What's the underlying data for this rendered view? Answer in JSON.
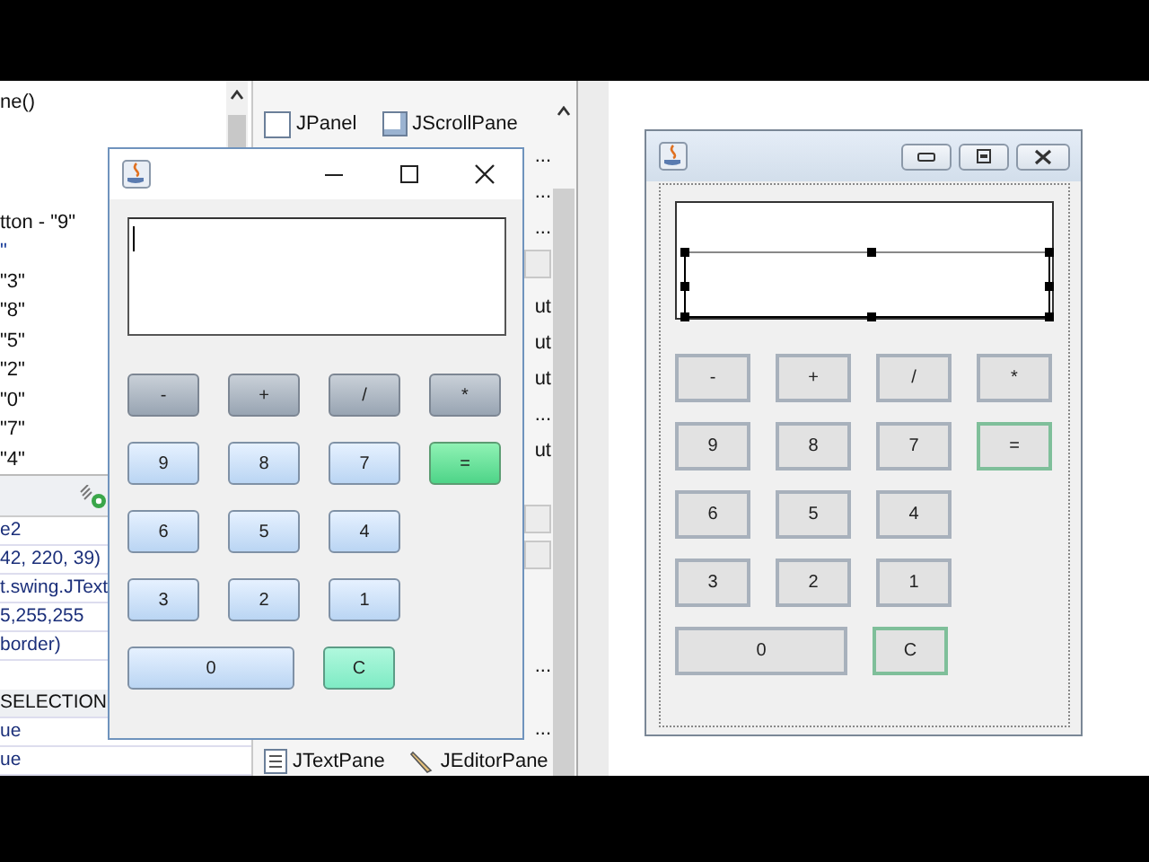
{
  "navigator": {
    "items": [
      "ne()",
      "tton - \"9\"",
      "\"",
      "\"3\"",
      "\"8\"",
      "\"5\"",
      "\"2\"",
      "\"0\"",
      "\"7\"",
      "\"4\""
    ]
  },
  "properties": {
    "rows": [
      {
        "text": "e2",
        "kind": "value"
      },
      {
        "text": "42, 220, 39)",
        "kind": "value"
      },
      {
        "text": "t.swing.JText",
        "kind": "value"
      },
      {
        "text": "5,255,255",
        "kind": "value"
      },
      {
        "text": "border)",
        "kind": "value"
      },
      {
        "text": "SELECTION",
        "kind": "section"
      },
      {
        "text": "ue",
        "kind": "value"
      },
      {
        "text": "ue",
        "kind": "value"
      }
    ]
  },
  "palette": {
    "top_row": [
      "JPanel",
      "JScrollPane"
    ],
    "entries": [
      {
        "kind": "item",
        "text": "..."
      },
      {
        "kind": "item",
        "text": "..."
      },
      {
        "kind": "item",
        "text": "..."
      },
      {
        "kind": "category"
      },
      {
        "kind": "item",
        "text": "ut"
      },
      {
        "kind": "item",
        "text": "ut"
      },
      {
        "kind": "item",
        "text": "ut"
      },
      {
        "kind": "item",
        "text": "..."
      },
      {
        "kind": "item",
        "text": "ut"
      },
      {
        "kind": "category"
      },
      {
        "kind": "category"
      },
      {
        "kind": "item",
        "text": "..."
      },
      {
        "kind": "item",
        "text": "..."
      }
    ],
    "bottom_row": [
      "JTextPane",
      "JEditorPane"
    ]
  },
  "running_window": {
    "rows": [
      {
        "keys": [
          {
            "label": "-",
            "kind": "operator",
            "wide": false
          },
          {
            "label": "+",
            "kind": "operator",
            "wide": false
          },
          {
            "label": "/",
            "kind": "operator",
            "wide": false
          },
          {
            "label": "*",
            "kind": "operator",
            "wide": false
          }
        ]
      },
      {
        "keys": [
          {
            "label": "9",
            "kind": "digit",
            "wide": false
          },
          {
            "label": "8",
            "kind": "digit",
            "wide": false
          },
          {
            "label": "7",
            "kind": "digit",
            "wide": false
          },
          {
            "label": "=",
            "kind": "equals",
            "wide": false
          }
        ]
      },
      {
        "keys": [
          {
            "label": "6",
            "kind": "digit",
            "wide": false
          },
          {
            "label": "5",
            "kind": "digit",
            "wide": false
          },
          {
            "label": "4",
            "kind": "digit",
            "wide": false
          }
        ]
      },
      {
        "keys": [
          {
            "label": "3",
            "kind": "digit",
            "wide": false
          },
          {
            "label": "2",
            "kind": "digit",
            "wide": false
          },
          {
            "label": "1",
            "kind": "digit",
            "wide": false
          }
        ]
      },
      {
        "keys": [
          {
            "label": "0",
            "kind": "digit",
            "wide": true
          },
          {
            "label": "C",
            "kind": "clear",
            "wide": false
          }
        ]
      }
    ]
  },
  "design_form": {
    "rows": [
      {
        "keys": [
          {
            "label": "-",
            "kind": "operator",
            "wide": false
          },
          {
            "label": "+",
            "kind": "operator",
            "wide": false
          },
          {
            "label": "/",
            "kind": "operator",
            "wide": false
          },
          {
            "label": "*",
            "kind": "operator",
            "wide": false
          }
        ]
      },
      {
        "keys": [
          {
            "label": "9",
            "kind": "digit",
            "wide": false
          },
          {
            "label": "8",
            "kind": "digit",
            "wide": false
          },
          {
            "label": "7",
            "kind": "digit",
            "wide": false
          },
          {
            "label": "=",
            "kind": "equals",
            "wide": false
          }
        ]
      },
      {
        "keys": [
          {
            "label": "6",
            "kind": "digit",
            "wide": false
          },
          {
            "label": "5",
            "kind": "digit",
            "wide": false
          },
          {
            "label": "4",
            "kind": "digit",
            "wide": false
          }
        ]
      },
      {
        "keys": [
          {
            "label": "3",
            "kind": "digit",
            "wide": false
          },
          {
            "label": "2",
            "kind": "digit",
            "wide": false
          },
          {
            "label": "1",
            "kind": "digit",
            "wide": false
          }
        ]
      },
      {
        "keys": [
          {
            "label": "0",
            "kind": "digit",
            "wide": true
          },
          {
            "label": "C",
            "kind": "clear",
            "wide": false
          }
        ]
      }
    ]
  }
}
